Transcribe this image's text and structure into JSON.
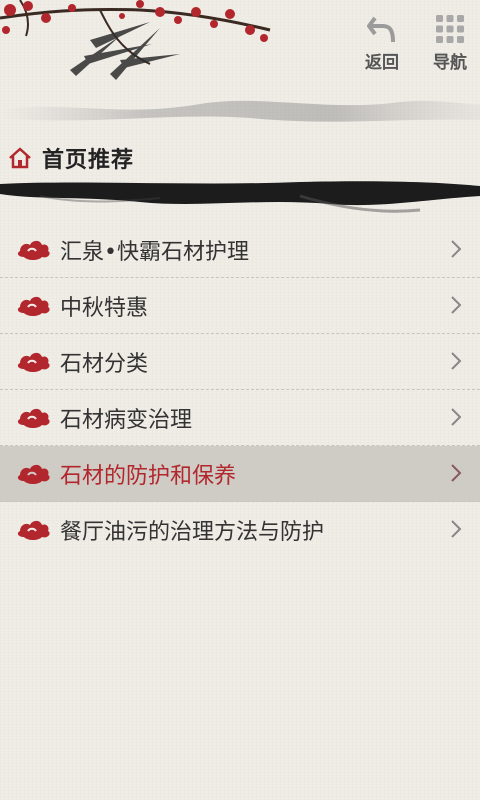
{
  "header": {
    "back_label": "返回",
    "guide_label": "导航",
    "back_icon": "back-arrow-icon",
    "guide_icon": "grid-icon"
  },
  "section": {
    "title": "首页推荐",
    "icon": "home-icon"
  },
  "list": {
    "items": [
      {
        "label": "汇泉•快霸石材护理",
        "icon": "cloud-icon"
      },
      {
        "label": "中秋特惠",
        "icon": "cloud-icon"
      },
      {
        "label": "石材分类",
        "icon": "cloud-icon"
      },
      {
        "label": "石材病变治理",
        "icon": "cloud-icon"
      },
      {
        "label": "石材的防护和保养",
        "icon": "cloud-icon",
        "selected": true
      },
      {
        "label": "餐厅油污的治理方法与防护",
        "icon": "cloud-icon"
      }
    ]
  },
  "colors": {
    "accent_red": "#b2272d",
    "background": "#f0ede7",
    "selected_row": "#cfcbc5"
  }
}
